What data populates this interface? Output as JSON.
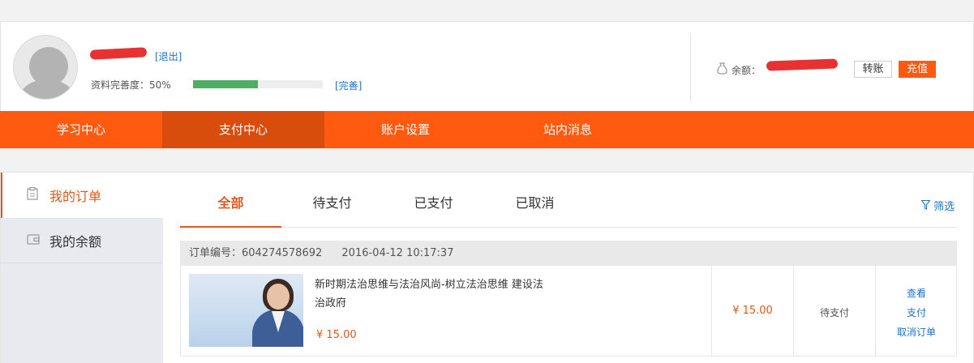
{
  "profile": {
    "logout_label": "[退出]",
    "completeness_label": "资料完善度：50%",
    "completeness_percent": 50,
    "complete_link": "[完善]",
    "balance_label": "余额：",
    "transfer_label": "转账",
    "recharge_label": "充值"
  },
  "nav": {
    "items": [
      {
        "label": "学习中心"
      },
      {
        "label": "支付中心"
      },
      {
        "label": "账户设置"
      },
      {
        "label": "站内消息"
      }
    ],
    "active_index": 1
  },
  "sidebar": {
    "items": [
      {
        "label": "我的订单"
      },
      {
        "label": "我的余额"
      }
    ]
  },
  "tabs": {
    "items": [
      {
        "label": "全部"
      },
      {
        "label": "待支付"
      },
      {
        "label": "已支付"
      },
      {
        "label": "已取消"
      }
    ],
    "filter_label": "筛选"
  },
  "order": {
    "number_label": "订单编号：604274578692",
    "time": "2016-04-12 10:17:37",
    "course_title_line1": "新时期法治思维与法治风尚-树立法治思维 建设法",
    "course_title_line2": "治政府",
    "course_price": "¥ 15.00",
    "amount": "¥ 15.00",
    "status": "待支付",
    "actions": {
      "view": "查看",
      "pay": "支付",
      "cancel": "取消订单"
    }
  },
  "colors": {
    "accent": "#ff5a0f",
    "nav_active": "#d94d0c",
    "link": "#1e73c8",
    "progress_fill": "#4caf62"
  }
}
